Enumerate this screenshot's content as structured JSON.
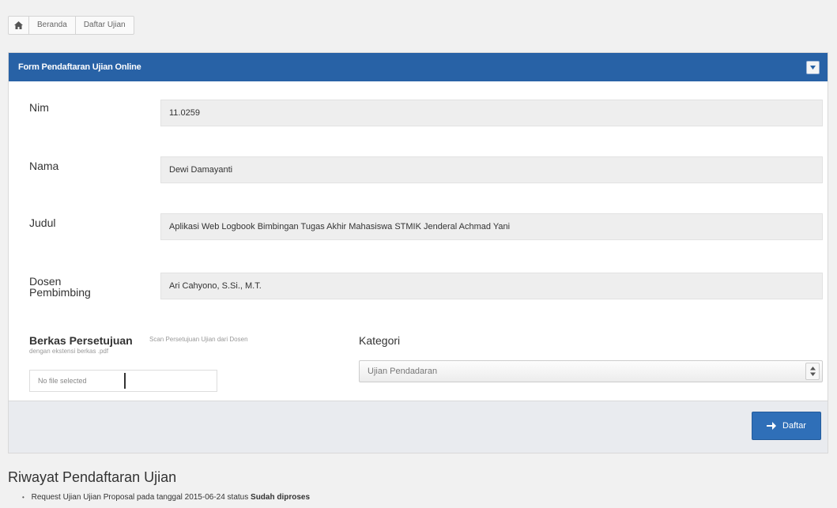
{
  "breadcrumb": {
    "home_icon": "home-icon",
    "items": [
      "Beranda",
      "Daftar Ujian"
    ]
  },
  "panel": {
    "title": "Form Pendaftaran Ujian Online",
    "toggle_icon": "caret-down-icon",
    "header_color": "#2862a6"
  },
  "form": {
    "nim": {
      "label": "Nim",
      "value": "11.0259"
    },
    "nama": {
      "label": "Nama",
      "value": "Dewi Damayanti"
    },
    "judul": {
      "label": "Judul",
      "value": "Aplikasi Web Logbook Bimbingan Tugas Akhir Mahasiswa STMIK Jenderal Achmad Yani"
    },
    "dosen": {
      "label_line1": "Dosen",
      "label_line2": "Pembimbing",
      "value": "Ari Cahyono, S.Si., M.T."
    },
    "berkas": {
      "label": "Berkas Persetujuan",
      "hint_line1": "Scan Persetujuan Ujian dari Dosen",
      "hint_line2": "dengan ekstensi berkas .pdf",
      "file_text": "No file selected"
    },
    "kategori": {
      "label": "Kategori",
      "selected": "Ujian Pendadaran"
    }
  },
  "footer": {
    "submit_label": "Daftar",
    "submit_icon": "arrow-right-icon",
    "button_color": "#2f6fb8"
  },
  "history": {
    "title": "Riwayat Pendaftaran Ujian",
    "items": [
      {
        "prefix": "Request Ujian",
        "exam": "Ujian Proposal",
        "mid": "pada tanggal 2015-06-24 status",
        "status": "Sudah diproses"
      }
    ]
  }
}
